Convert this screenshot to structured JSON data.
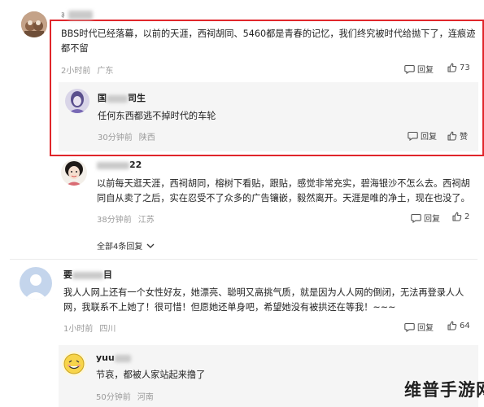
{
  "comments": [
    {
      "username_suffix": "",
      "text": "BBS时代已经落幕，以前的天涯，西祠胡同、5460都是青春的记忆，我们终究被时代给抛下了，连痕迹都不留",
      "time": "2小时前",
      "location": "广东",
      "reply_label": "回复",
      "like_count": "73",
      "reply": {
        "username_prefix": "国",
        "username_suffix": "司生",
        "text": "任何东西都逃不掉时代的车轮",
        "time": "30分钟前",
        "location": "陕西",
        "reply_label": "回复",
        "like_label": "赞"
      }
    },
    {
      "username_suffix": "22",
      "text": "以前每天逛天涯，西祠胡同，榕树下看贴，跟贴，感觉非常充实，碧海银沙不怎么去。西祠胡同自从卖了之后，实在忍受不了众多的广告镶嵌，毅然离开。天涯是唯的净土，现在也没了。",
      "time": "38分钟前",
      "location": "江苏",
      "reply_label": "回复",
      "like_count": "2"
    },
    {
      "expand_label": "全部4条回复"
    },
    {
      "username_prefix": "要",
      "username_suffix": "目",
      "text": "我人人网上还有一个女性好友，她漂亮、聪明又高挑气质，就是因为人人网的倒闭，无法再登录人人网，我联系不上她了！很可惜！但愿她还单身吧，希望她没有被拱还在等我！~~~",
      "time": "1小时前",
      "location": "四川",
      "reply_label": "回复",
      "like_count": "64"
    },
    {
      "username_prefix": "yuu",
      "text": "节哀，都被人家站起来撸了",
      "time": "50分钟前",
      "location": "河南"
    }
  ],
  "watermark": "维普手游网",
  "colors": {
    "highlight": "#e0262b",
    "meta": "#9a9a9a",
    "reply_bg": "#f5f5f5"
  }
}
